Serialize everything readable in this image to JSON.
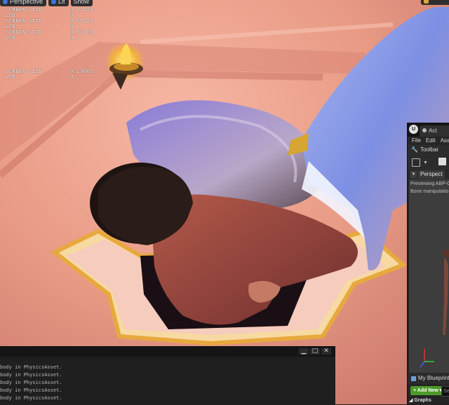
{
  "viewport": {
    "toolbar": {
      "perspective_label": "Perspective",
      "lit_label": "Lit",
      "show_label": "Show"
    },
    "lod_stats": [
      {
        "key": "SCREEN SIZE",
        "value": "0.22220"
      },
      {
        "key": "LOD",
        "value": "0."
      },
      {
        "key": "SCREEN SIZE",
        "value": "0.65120"
      },
      {
        "key": "LOD",
        "value": "0."
      },
      {
        "key": "SCREEN SIZE",
        "value": "0.53169"
      },
      {
        "key": "LOD",
        "value": "0."
      },
      {
        "key": "SCREEN SIZE",
        "value": "0.19065"
      },
      {
        "key": "LOD",
        "value": "0."
      }
    ]
  },
  "output_log": {
    "window_buttons": {
      "minimize": "▁",
      "maximize": "□",
      "close": "✕"
    },
    "lines": [
      "body in PhysicsAsset.",
      "body in PhysicsAsset.",
      "body in PhysicsAsset.",
      "body in PhysicsAsset.",
      "body in PhysicsAsset."
    ]
  },
  "editor_panel": {
    "logo_text": "U",
    "tab_label": "Act",
    "menu": [
      "File",
      "Edit",
      "Ass"
    ],
    "toolbar_title": "Toolbar",
    "preview": {
      "perspective_label": "Perspect",
      "lines": [
        "Previewing ABP-G",
        "Bone manipulatio"
      ]
    },
    "my_blueprint_label": "My Blueprint",
    "add_new_label": "+ Add New ▾",
    "search_placeholder": "Se",
    "graphs_label": "◢ Graphs"
  },
  "colors": {
    "background_warm": "#e9a08a",
    "accent_gold": "#f2b94a",
    "add_new_green": "#4c9a2a",
    "ue_blue": "#3b79d6"
  }
}
